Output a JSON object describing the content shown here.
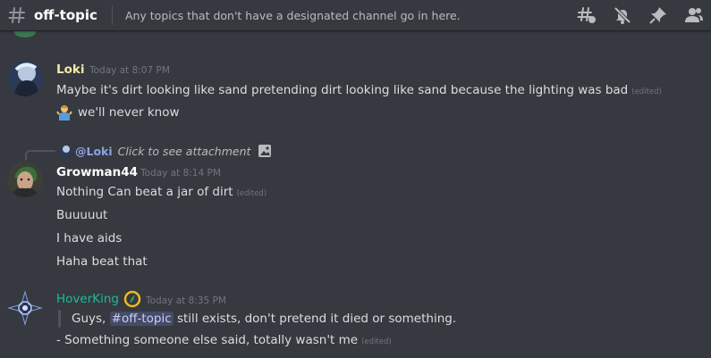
{
  "header": {
    "channel_name": "off-topic",
    "topic": "Any topics that don't have a designated channel go in here.",
    "icons": [
      "threads-icon",
      "mute-bell-icon",
      "pin-icon",
      "member-list-icon"
    ]
  },
  "messages": [
    {
      "username": "Loki",
      "username_color": "#f8e7a5",
      "timestamp": "Today at 8:07 PM",
      "lines": [
        {
          "text": "Maybe it's dirt looking like sand pretending dirt looking like sand because the lighting was bad",
          "edited": "(edited)"
        },
        {
          "emoji": "person-shrugging",
          "text": "we'll never know"
        }
      ]
    },
    {
      "reply": {
        "name": "@Loki",
        "cta": "Click to see attachment",
        "icon": "image-icon"
      },
      "username": "Growman44",
      "username_color": "#ffffff",
      "timestamp": "Today at 8:14 PM",
      "lines": [
        {
          "text": "Nothing Can beat a jar of dirt",
          "edited": "(edited)"
        },
        {
          "text": "Buuuuut"
        },
        {
          "text": "I have aids"
        },
        {
          "text": "Haha beat that"
        }
      ]
    },
    {
      "username": "HoverKing",
      "username_color": "#1abc9c",
      "timestamp": "Today at 8:35 PM",
      "badge": "compass-badge-icon",
      "quote": {
        "before": "Guys,",
        "mention": "#off-topic",
        "after": "still exists, don't pretend it died or something."
      },
      "lines": [
        {
          "text": "- Something someone else said, totally wasn't me",
          "edited": "(edited)"
        }
      ]
    }
  ]
}
